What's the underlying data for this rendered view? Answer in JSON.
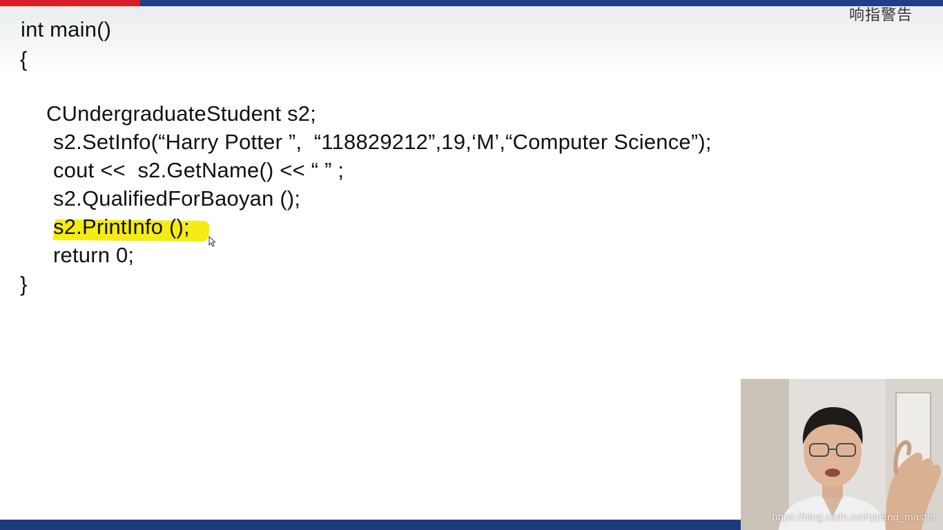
{
  "watermark_top": "响指警告",
  "code_lines": [
    "int main()",
    "{",
    "CUndergraduateStudent s2;",
    "s2.SetInfo(“Harry Potter ”,  “118829212”,19,‘M’,“Computer Science”);",
    "cout <<  s2.GetName() << “ ” ;",
    "s2.QualifiedForBaoyan ();",
    "s2.PrintInfo ();",
    "return 0;",
    "}"
  ],
  "url_watermark": "https://blog.csdn.net/qipeng_master",
  "colors": {
    "top_bar_red": "#d62027",
    "top_bar_blue": "#1f3f88",
    "bottom_bar": "#1e3a7e",
    "highlight": "#f5ec13"
  },
  "icons": {
    "cursor": "mouse-pointer-icon"
  }
}
